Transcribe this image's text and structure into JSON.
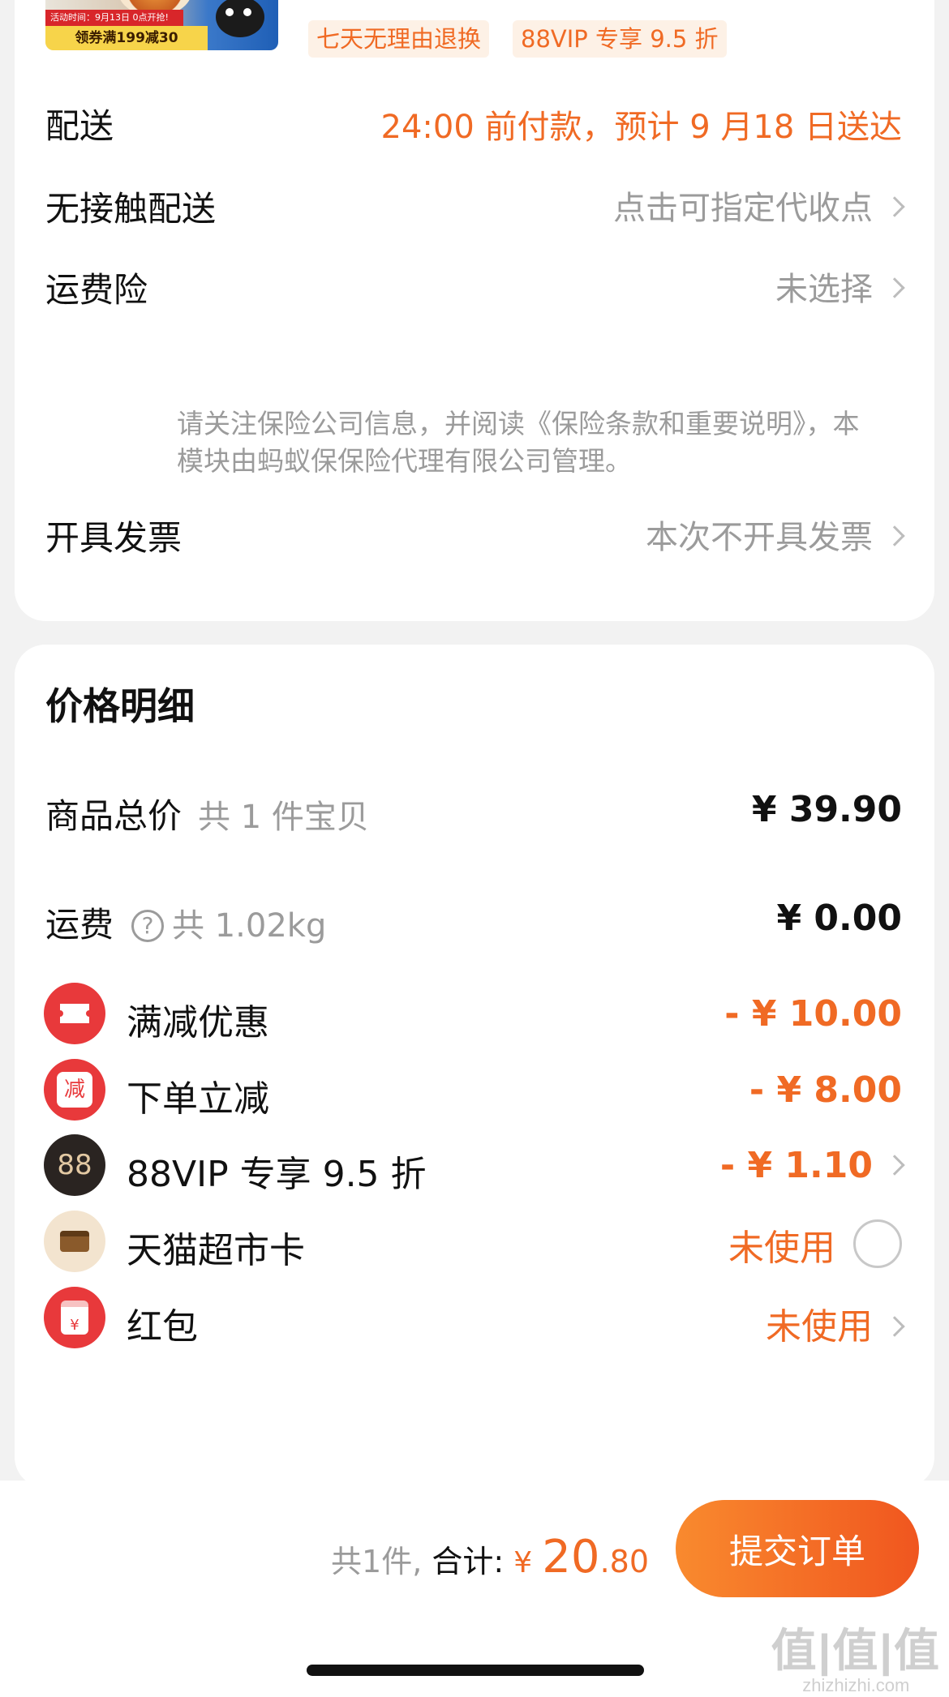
{
  "product": {
    "thumb_line1": "活动时间：9月13日 0点开抢!",
    "thumb_line2": "领券满199减30",
    "tags": [
      "七天无理由退换",
      "88VIP 专享 9.5 折"
    ]
  },
  "order_options": {
    "delivery": {
      "label": "配送",
      "value": "24:00 前付款，预计 9 月18 日送达"
    },
    "contactless": {
      "label": "无接触配送",
      "value": "点击可指定代收点"
    },
    "shipping_insurance": {
      "label": "运费险",
      "value": "未选择",
      "note": "请关注保险公司信息，并阅读《保险条款和重要说明》，本模块由蚂蚁保保险代理有限公司管理。"
    },
    "invoice": {
      "label": "开具发票",
      "value": "本次不开具发票"
    }
  },
  "price_detail": {
    "title": "价格明细",
    "goods_total": {
      "label": "商品总价",
      "sub": "共 1 件宝贝",
      "value": "¥ 39.90"
    },
    "shipping": {
      "label": "运费",
      "help_icon": "?",
      "sub": "共 1.02kg",
      "value": "¥ 0.00"
    },
    "discounts": [
      {
        "icon": "ticket-icon",
        "badge_text": "",
        "label": "满减优惠",
        "value": "- ¥ 10.00",
        "color": "#e8393b"
      },
      {
        "icon": "jian-icon",
        "badge_text": "减",
        "label": "下单立减",
        "value": "- ¥ 8.00",
        "color": "#e8393b"
      },
      {
        "icon": "vip88-icon",
        "badge_text": "88",
        "label": "88VIP 专享 9.5 折",
        "value": "- ¥ 1.10",
        "color": "#2a2421"
      },
      {
        "icon": "card-icon",
        "badge_text": "",
        "label": "天猫超市卡",
        "value": "未使用",
        "color": "#f3e4cf"
      },
      {
        "icon": "redpacket-icon",
        "badge_text": "¥",
        "label": "红包",
        "value": "未使用",
        "color": "#e8393b"
      }
    ]
  },
  "footer": {
    "count_text": "共1件,",
    "total_label": "合计:",
    "currency": "¥",
    "total_int": "20",
    "total_dec": ".80",
    "submit_label": "提交订单",
    "watermark_top": "值|值|值",
    "watermark_bottom": "zhizhizhi.com"
  },
  "colors": {
    "accent": "#f06a24",
    "muted": "#9b9b9b",
    "background": "#f2f2f2"
  }
}
